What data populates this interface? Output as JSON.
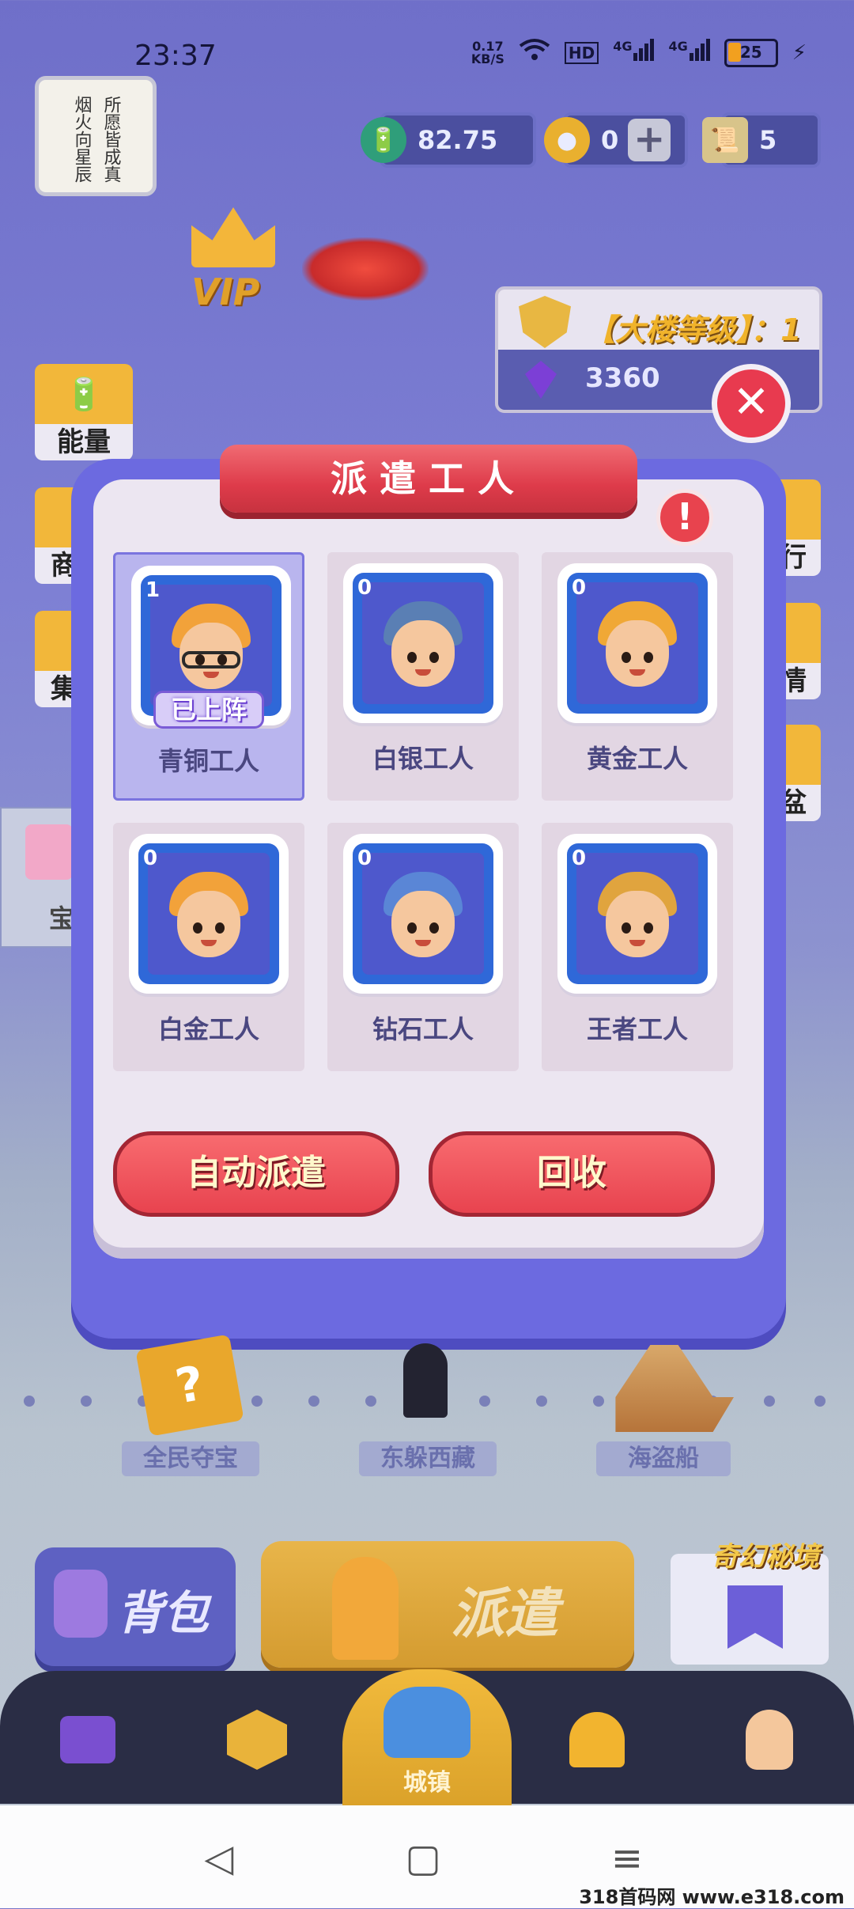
{
  "status_bar": {
    "time": "23:37",
    "net_speed": "0.17",
    "net_unit": "KB/S",
    "hd": "HD",
    "signal1": "4G",
    "signal2": "4G",
    "battery": "25"
  },
  "avatar_poem": {
    "line1": "烟火向星辰",
    "line2": "所愿皆成真"
  },
  "resources": {
    "energy": "82.75",
    "coins": "0",
    "scrolls": "5"
  },
  "vip_label": "VIP",
  "building": {
    "title": "【大楼等级】：1",
    "gems": "3360"
  },
  "side_buttons": [
    {
      "label": "能量"
    },
    {
      "label": "商"
    },
    {
      "label": "集"
    },
    {
      "label": "行"
    },
    {
      "label": "情"
    },
    {
      "label": "盆"
    },
    {
      "label": "宝"
    }
  ],
  "dialog": {
    "title": "派遣工人",
    "deployed_label": "已上阵",
    "workers": [
      {
        "name": "青铜工人",
        "count": "1",
        "active": true,
        "helmet": "#f2a23a"
      },
      {
        "name": "白银工人",
        "count": "0",
        "active": false,
        "helmet": "#5a7fb4"
      },
      {
        "name": "黄金工人",
        "count": "0",
        "active": false,
        "helmet": "#f0a836"
      },
      {
        "name": "白金工人",
        "count": "0",
        "active": false,
        "helmet": "#f2a23a"
      },
      {
        "name": "钻石工人",
        "count": "0",
        "active": false,
        "helmet": "#5a86d6"
      },
      {
        "name": "王者工人",
        "count": "0",
        "active": false,
        "helmet": "#e0a43e"
      }
    ],
    "auto_dispatch": "自动派遣",
    "recycle": "回收"
  },
  "map_labels": {
    "label1": "全民夺宝",
    "label2": "东躲西藏",
    "label3": "海盗船"
  },
  "bottom_buttons": {
    "bag": "背包",
    "dispatch": "派遣",
    "fantasy": "奇幻秘境"
  },
  "tabbar": {
    "center_label": "城镇"
  },
  "watermark": "318首码网 www.e318.com"
}
